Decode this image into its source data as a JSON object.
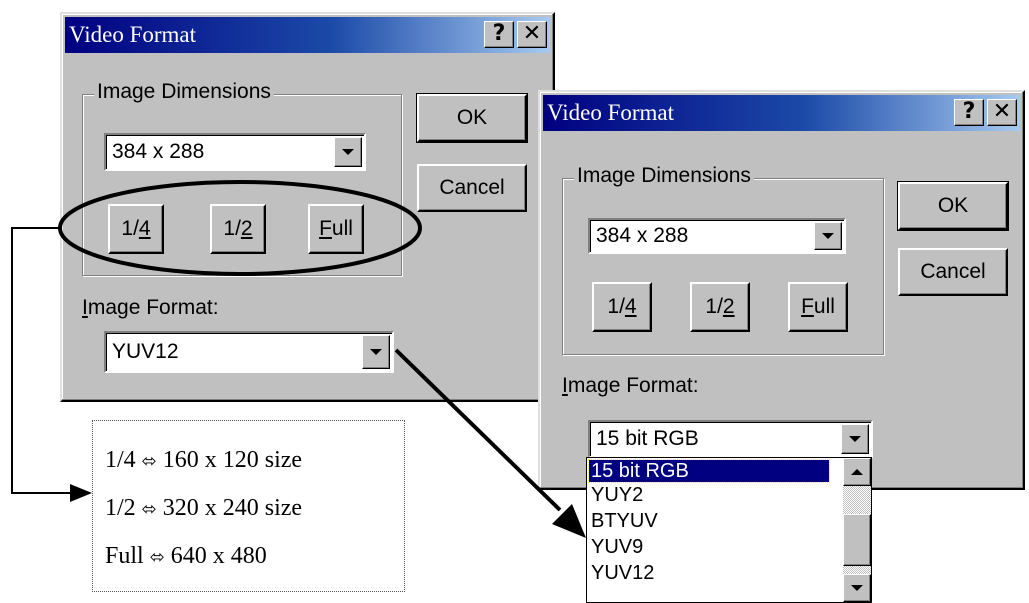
{
  "dialog_left": {
    "title": "Video Format",
    "help_button": "?",
    "close_button": "✕",
    "image_dimensions": {
      "group_label": "Image Dimensions",
      "size_value": "384 x 288",
      "quarter_prefix": "1/",
      "quarter_mnemonic": "4",
      "half_prefix": "1/",
      "half_mnemonic": "2",
      "full_mnemonic": "F",
      "full_rest": "ull"
    },
    "image_format_mnemonic": "I",
    "image_format_rest": "mage Format:",
    "image_format_value": "YUV12",
    "ok_label": "OK",
    "cancel_label": "Cancel"
  },
  "dialog_right": {
    "title": "Video Format",
    "help_button": "?",
    "close_button": "✕",
    "image_dimensions": {
      "group_label": "Image Dimensions",
      "size_value": "384 x 288",
      "quarter_prefix": "1/",
      "quarter_mnemonic": "4",
      "half_prefix": "1/",
      "half_mnemonic": "2",
      "full_mnemonic": "F",
      "full_rest": "ull"
    },
    "image_format_mnemonic": "I",
    "image_format_rest": "mage Format:",
    "image_format_value": "15 bit RGB",
    "ok_label": "OK",
    "cancel_label": "Cancel",
    "format_options": [
      "15 bit RGB",
      "YUY2",
      "BTYUV",
      "YUV9",
      "YUV12"
    ],
    "selected_option": "15 bit RGB"
  },
  "annotation": {
    "lines": [
      {
        "size": "1/4",
        "arrow": "⬄",
        "result": "160 x 120 size"
      },
      {
        "size": "1/2",
        "arrow": "⬄",
        "result": "320 x 240 size"
      },
      {
        "size": "Full",
        "arrow": "⬄",
        "result": "640 x 480"
      }
    ]
  },
  "colors": {
    "dialog_face": "#c0c0c0",
    "title_gradient_start": "#000080",
    "title_gradient_end": "#a6caf0",
    "selection": "#000080"
  }
}
